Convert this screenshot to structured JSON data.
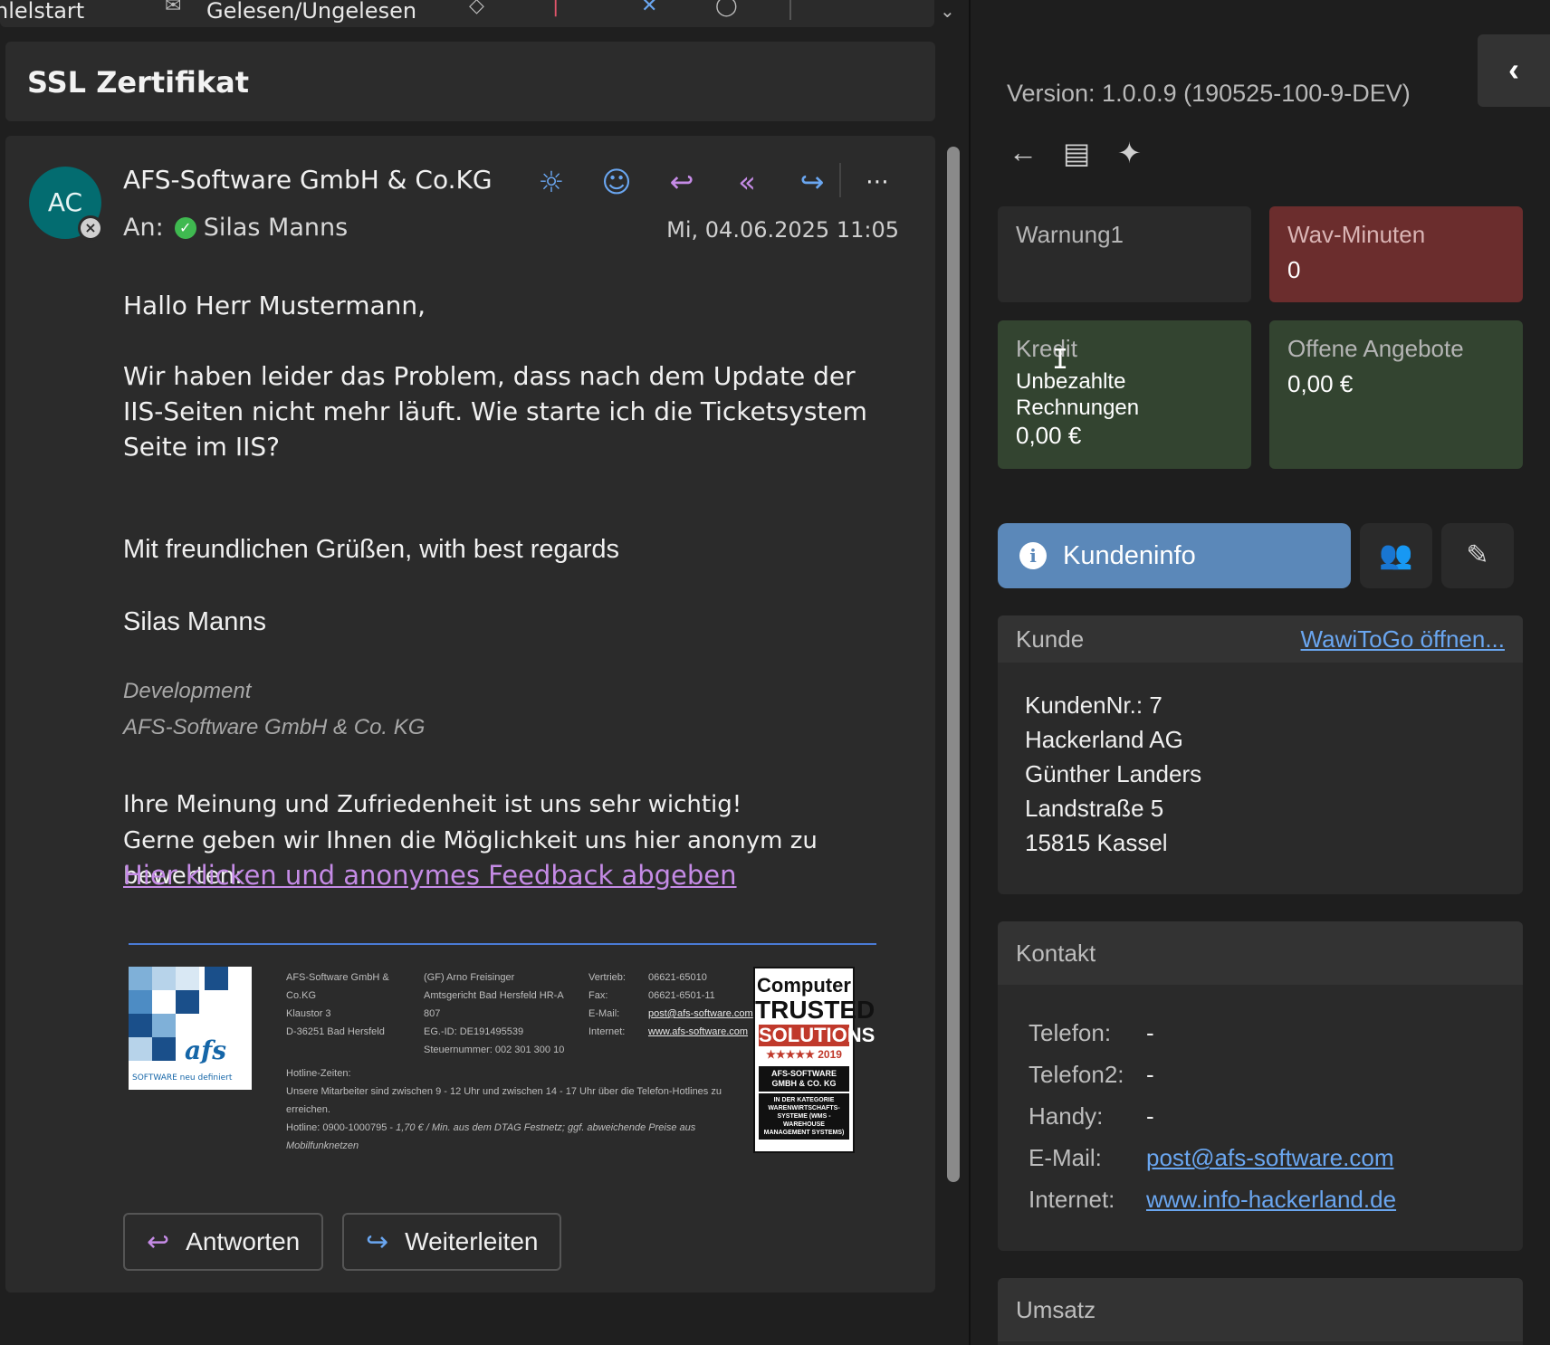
{
  "toolbar": {
    "home_label": "nlelstart",
    "read_label": "Gelesen/Ungelesen"
  },
  "mail": {
    "subject": "SSL Zertifikat",
    "avatar_initials": "AC",
    "sender": "AFS-Software GmbH & Co.KG",
    "to_prefix": "An:",
    "to_name": "Silas Manns",
    "date": "Mi, 04.06.2025 11:05",
    "greeting": "Hallo Herr Mustermann,",
    "paragraph": "Wir haben leider das Problem, dass nach dem Update der IIS-Seiten nicht mehr läuft. Wie starte ich die Ticketsystem Seite im IIS?",
    "closing": "Mit freundlichen Grüßen, with best regards",
    "signature_name": "Silas Manns",
    "signature_role": "Development",
    "signature_company": "AFS-Software GmbH & Co. KG",
    "feedback_line1": "Ihre Meinung und Zufriedenheit ist uns sehr wichtig!",
    "feedback_line2": "Gerne geben wir Ihnen die Möglichkeit uns hier anonym zu bewerten:",
    "feedback_link": "Hier klicken und anonymes Feedback abgeben",
    "reply_label": "Antworten",
    "forward_label": "Weiterleiten"
  },
  "signature_block": {
    "logo_word": "afs",
    "logo_sub_word": "software",
    "logo_tagline": "SOFTWARE neu definiert",
    "address": [
      "AFS-Software GmbH &",
      "Co.KG",
      "Klaustor 3",
      "D-36251 Bad Hersfeld"
    ],
    "legal": [
      "(GF)  Arno Freisinger",
      "Amtsgericht Bad Hersfeld HR-A",
      "807",
      "EG.-ID:  DE191495539",
      "Steuernummer: 002 301 300 10"
    ],
    "contact_labels": [
      "Vertrieb:",
      "Fax:",
      "E-Mail:",
      "Internet:"
    ],
    "contact_values": [
      "06621-65010",
      "06621-6501-11",
      "post@afs-software.com",
      "www.afs-software.com"
    ],
    "hotline_title": "Hotline-Zeiten:",
    "hotline_text": "Unsere Mitarbeiter sind zwischen 9 - 12 Uhr und zwischen 14 - 17 Uhr über die Telefon-Hotlines zu erreichen.",
    "hotline_number": "Hotline: 0900-1000795",
    "hotline_price": "1,70 € / Min. aus dem DTAG Festnetz; ggf. abweichende Preise aus Mobilfunknetzen",
    "badge": {
      "line1": "Computer",
      "line2": "TRUSTED",
      "line3": "SOLUTIONS",
      "year": "2019",
      "company": "AFS-SOFTWARE GMBH & CO. KG",
      "category": "IN DER KATEGORIE WARENWIRTSCHAFTS-SYSTEME (WMS - WAREHOUSE MANAGEMENT SYSTEMS)"
    }
  },
  "crm": {
    "version": "Version: 1.0.0.9 (190525-100-9-DEV)",
    "tiles": {
      "warnung_label": "Warnung1",
      "wav_label": "Wav-Minuten",
      "wav_value": "0",
      "kredit_label": "Kredit",
      "unbezahlt_label": "Unbezahlte Rechnungen",
      "unbezahlt_value": "0,00 €",
      "angebote_label": "Offene Angebote",
      "angebote_value": "0,00 €"
    },
    "kundeninfo_label": "Kundeninfo",
    "kunde": {
      "title": "Kunde",
      "link": "WawiToGo öffnen...",
      "kunden_nr": "KundenNr.: 7",
      "firma": "Hackerland AG",
      "name": "Günther Landers",
      "strasse": "Landstraße 5",
      "ort": "15815 Kassel"
    },
    "kontakt": {
      "title": "Kontakt",
      "telefon_label": "Telefon:",
      "telefon_value": "-",
      "telefon2_label": "Telefon2:",
      "telefon2_value": "-",
      "handy_label": "Handy:",
      "handy_value": "-",
      "email_label": "E-Mail:",
      "email_value": "post@afs-software.com",
      "internet_label": "Internet:",
      "internet_value": "www.info-hackerland.de"
    },
    "umsatz_title": "Umsatz"
  },
  "colors": {
    "accent_blue": "#5b88b9",
    "alert_red": "#6b2d2d",
    "tile_green": "#334430",
    "link_purple": "#c58be6",
    "link_blue": "#6aa6f0",
    "avatar_teal": "#036c70"
  },
  "icons": {
    "mail_actions": [
      "sun-icon",
      "emoji-icon",
      "reply-icon",
      "reply-all-icon",
      "forward-icon",
      "more-icon"
    ],
    "crm_actions": [
      "back-arrow-icon",
      "archive-icon",
      "sparkle-icon"
    ]
  }
}
